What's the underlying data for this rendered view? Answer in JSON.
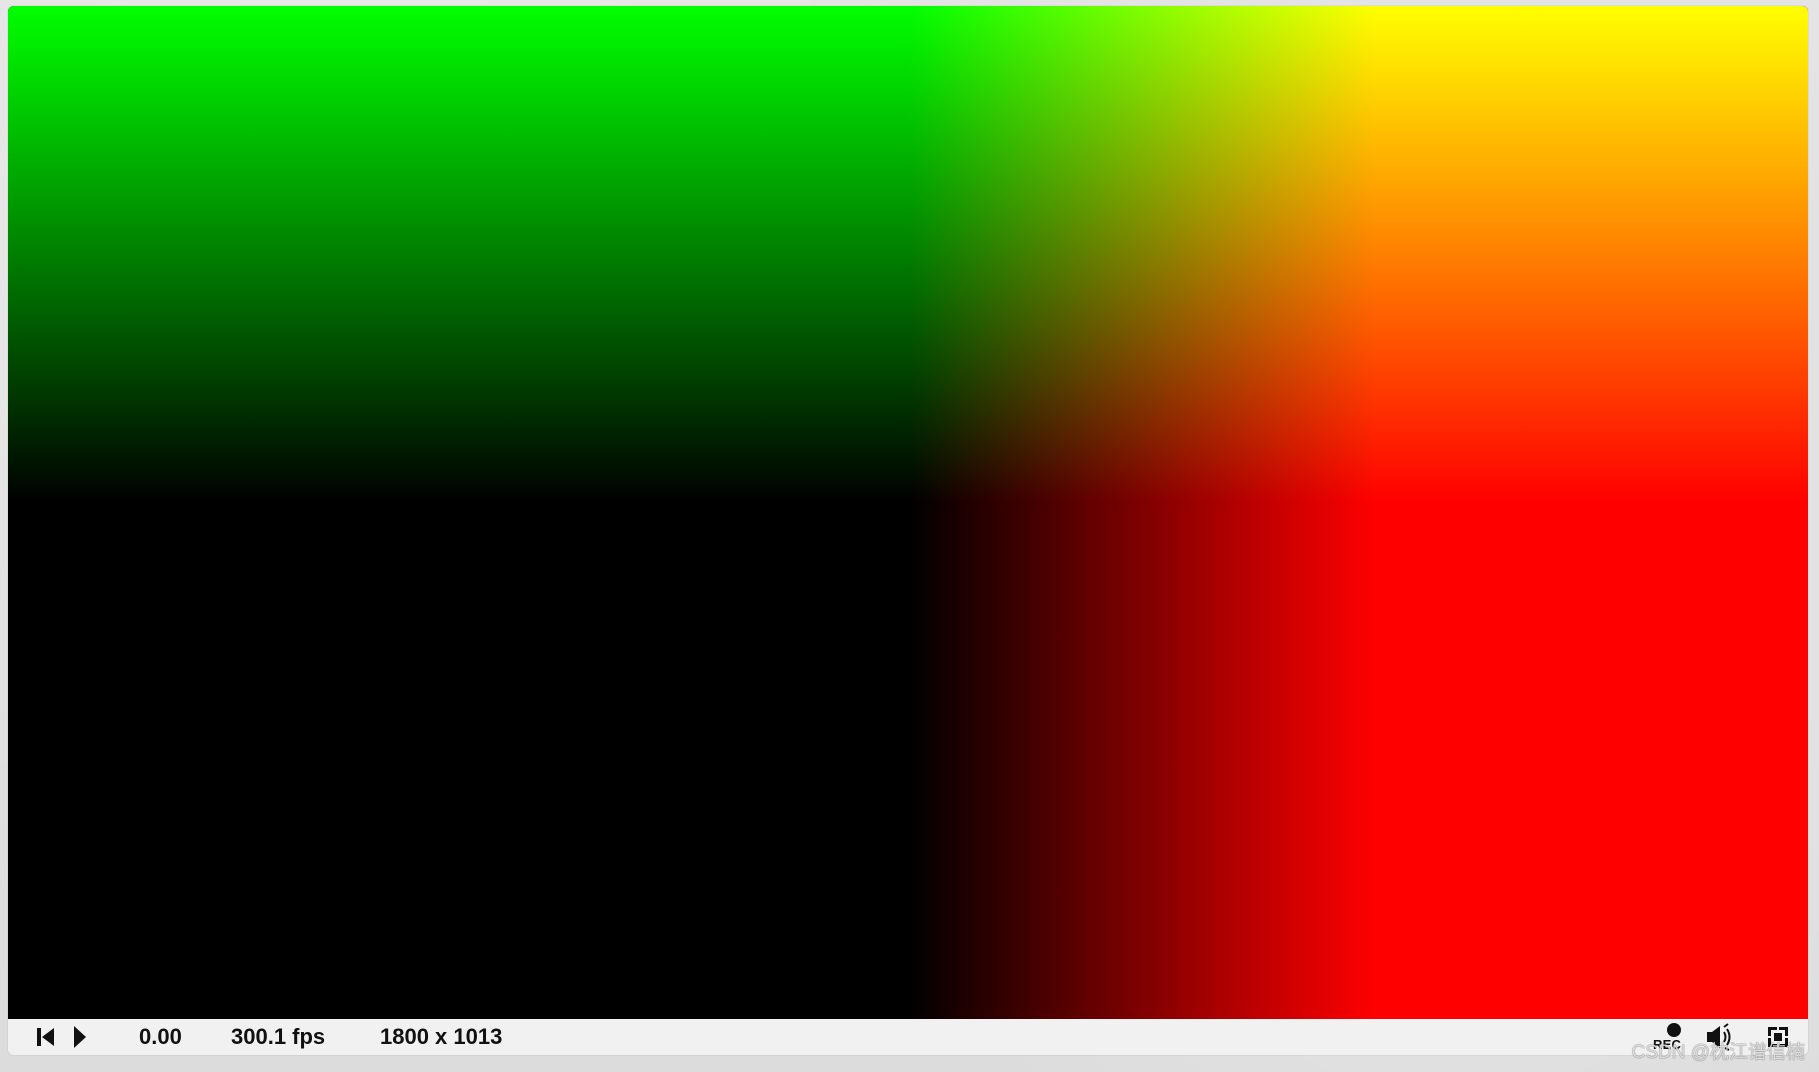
{
  "player": {
    "time": "0.00",
    "fps": "300.1 fps",
    "resolution": "1800 x 1013",
    "rec_label": "REC"
  },
  "icons": {
    "rewind": "skip-back-icon",
    "play": "play-icon",
    "record": "record-icon",
    "volume": "volume-icon",
    "fullscreen": "fullscreen-icon"
  },
  "colors": {
    "page_background": "#e2e2e2",
    "controls_background": "#f1f1f1",
    "control_text": "#111111",
    "gradient_top_left": "#00ff00",
    "gradient_top_right": "#ffff00",
    "gradient_bottom_left": "#000000",
    "gradient_bottom_right": "#ff0000"
  },
  "watermark": "CSDN @枕江谱信楠"
}
